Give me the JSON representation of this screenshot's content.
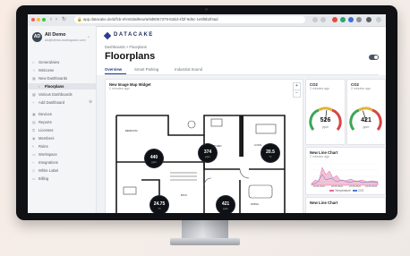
{
  "browser": {
    "url": "app.datacake.de/d/fcb-ehm0dwl9vw/a/9d8067379-63dd-4f2f-9d6c-1e5f6b2f4ad"
  },
  "sidebar": {
    "workspace_initials": "AD",
    "workspace_name": "All Demo",
    "workspace_sub": "ws@demo-workspace.com",
    "items": [
      {
        "label": "Generalview",
        "icon": "home-icon"
      },
      {
        "label": "Welcome",
        "icon": "star-icon"
      },
      {
        "label": "New Dashboards",
        "icon": "grid-icon"
      },
      {
        "label": "Floorplans",
        "icon": "map-icon"
      },
      {
        "label": "Various Dashboards",
        "icon": "grid-icon"
      },
      {
        "label": "Add Dashboard",
        "icon": "plus-icon"
      },
      {
        "label": "Devices",
        "icon": "chip-icon"
      },
      {
        "label": "Reports",
        "icon": "file-icon"
      },
      {
        "label": "Licenses",
        "icon": "key-icon"
      },
      {
        "label": "Members",
        "icon": "users-icon"
      },
      {
        "label": "Rules",
        "icon": "bolt-icon"
      },
      {
        "label": "Workspace",
        "icon": "briefcase-icon"
      },
      {
        "label": "Integrations",
        "icon": "plug-icon"
      },
      {
        "label": "White Label",
        "icon": "tag-icon"
      },
      {
        "label": "Billing",
        "icon": "card-icon"
      }
    ]
  },
  "header": {
    "brand": "DATACAKE",
    "breadcrumbs": "Dashboards  >  Floorplans",
    "title": "Floorplans"
  },
  "tabs": [
    {
      "label": "Overview"
    },
    {
      "label": "Smart Parking"
    },
    {
      "label": "Industrial Sound"
    }
  ],
  "floorplan": {
    "title": "New Image Map Widget",
    "subtitle": "2 minutes ago",
    "sensors": [
      {
        "value": "440",
        "unit": "ppm"
      },
      {
        "value": "374",
        "unit": "ppm"
      },
      {
        "value": "20.5",
        "unit": "°C"
      },
      {
        "value": "24.75",
        "unit": "°C"
      },
      {
        "value": "421",
        "unit": "ppm"
      }
    ]
  },
  "gauges": [
    {
      "title": "CO2",
      "subtitle": "2 minutes ago",
      "value": "526",
      "unit": "ppm",
      "level": 0.53
    },
    {
      "title": "CO2",
      "subtitle": "2 minutes ago",
      "value": "421",
      "unit": "ppm",
      "level": 0.42
    }
  ],
  "line_chart": {
    "title": "New Line Chart",
    "subtitle": "2 minutes ago",
    "x_ticks": [
      "18.05.2022",
      "20.05.2022",
      "22.05.2022",
      "24.05.2022"
    ],
    "legend": [
      "Temperature",
      "CO2"
    ],
    "colors": {
      "temperature": "#e26a9a",
      "co2": "#4f7bd9"
    }
  },
  "bottom_card": {
    "title": "New Line Chart"
  },
  "colors": {
    "accent": "#1e3a8a",
    "gauge_green": "#3aa757",
    "gauge_red": "#d64545",
    "gauge_yellow": "#e0b43c"
  }
}
